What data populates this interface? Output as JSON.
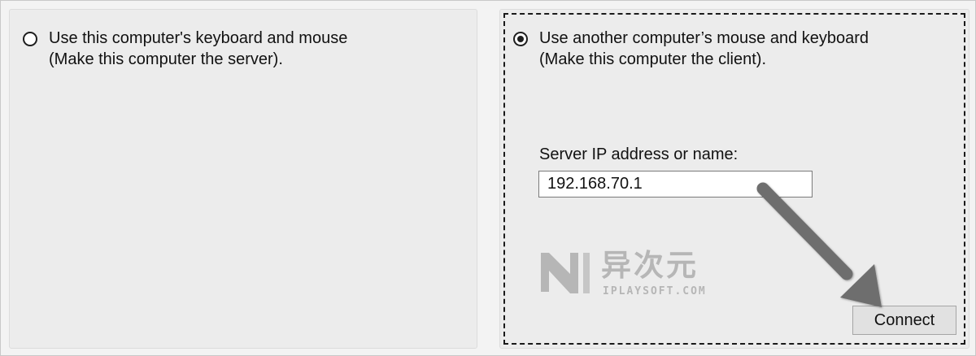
{
  "server_option": {
    "line1": "Use this computer's keyboard and mouse",
    "line2": "(Make this computer the server).",
    "selected": false
  },
  "client_option": {
    "line1": "Use another computer’s mouse and keyboard",
    "line2": "(Make this computer the client).",
    "selected": true,
    "server_label": "Server IP address or name:",
    "server_ip": "192.168.70.1",
    "connect_label": "Connect"
  },
  "watermark": {
    "text_cn": "异次元",
    "text_en": "IPLAYSOFT.COM",
    "icon": "iplaysoft-logo-icon"
  },
  "annotation": {
    "icon": "pointer-arrow-icon",
    "color": "#6e6e6e"
  }
}
